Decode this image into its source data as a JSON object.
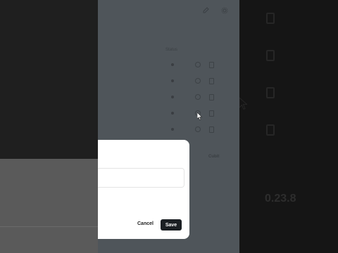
{
  "table": {
    "column_header": "Status",
    "rows": 5
  },
  "side_link": "Cubit",
  "version": "0.23.8",
  "dialog": {
    "field_value": "",
    "cancel_label": "Cancel",
    "save_label": "Save"
  },
  "icons": [
    "edit-icon",
    "settings-icon",
    "status-dot-icon",
    "radio-icon",
    "copy-icon",
    "mouse-cursor-icon"
  ],
  "colors": {
    "overlay": "#4f555a",
    "primary_button": "#1b1f23"
  }
}
